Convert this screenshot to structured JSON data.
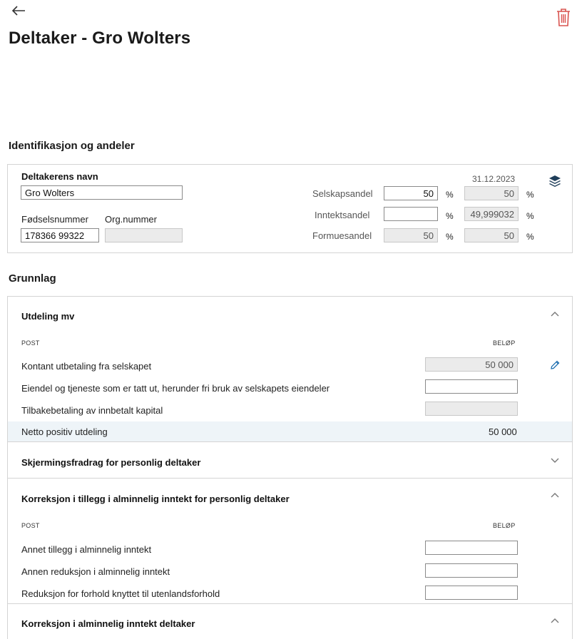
{
  "header": {
    "title": "Deltaker - Gro Wolters",
    "back_icon": "arrow-left-icon",
    "delete_icon": "trash-icon",
    "delete_color": "#d9534f"
  },
  "identification": {
    "section_title": "Identifikasjon og andeler",
    "name_label": "Deltakerens navn",
    "name_value": "Gro Wolters",
    "birth_number_label": "Fødselsnummer",
    "birth_number_value": "178366 99322",
    "org_number_label": "Org.nummer",
    "org_number_value": "",
    "date": "31.12.2023",
    "layers_icon": "layers-icon",
    "shares": [
      {
        "label": "Selskapsandel",
        "input": "50",
        "unit": "%",
        "value": "50",
        "unit2": "%"
      },
      {
        "label": "Inntektsandel",
        "input": "",
        "unit": "%",
        "value": "49,999032",
        "unit2": "%"
      },
      {
        "label": "Formuesandel",
        "input": "50",
        "unit": "%",
        "value": "50",
        "unit2": "%"
      }
    ]
  },
  "grunnlag": {
    "section_title": "Grunnlag",
    "groups": [
      {
        "title": "Utdeling mv",
        "expanded": true,
        "col_post": "POST",
        "col_amount": "BELØP",
        "rows": [
          {
            "label": "Kontant utbetaling fra selskapet",
            "value": "50 000"
          },
          {
            "label": "Eiendel og tjeneste som er tatt ut, herunder fri bruk av selskapets eiendeler",
            "value": ""
          },
          {
            "label": "Tilbakebetaling av innbetalt kapital",
            "value": ""
          }
        ],
        "total_label": "Netto positiv utdeling",
        "total_value": "50 000",
        "edit_icon": "pencil-icon"
      },
      {
        "title": "Skjermingsfradrag for personlig deltaker",
        "expanded": false
      },
      {
        "title": "Korreksjon i tillegg i alminnelig inntekt for personlig deltaker",
        "expanded": true,
        "col_post": "POST",
        "col_amount": "BELØP",
        "rows": [
          {
            "label": "Annet tillegg i alminnelig inntekt",
            "value": ""
          },
          {
            "label": "Annen reduksjon i alminnelig inntekt",
            "value": ""
          },
          {
            "label": "Reduksjon for forhold knyttet til utenlandsforhold",
            "value": ""
          }
        ]
      },
      {
        "title": "Korreksjon i alminnelig inntekt deltaker",
        "expanded": true
      }
    ]
  },
  "colors": {
    "accent": "#1f6fb0",
    "border": "#d4d4d4",
    "readonly_bg": "#ebebeb",
    "highlight_bg": "#eef4f8"
  }
}
